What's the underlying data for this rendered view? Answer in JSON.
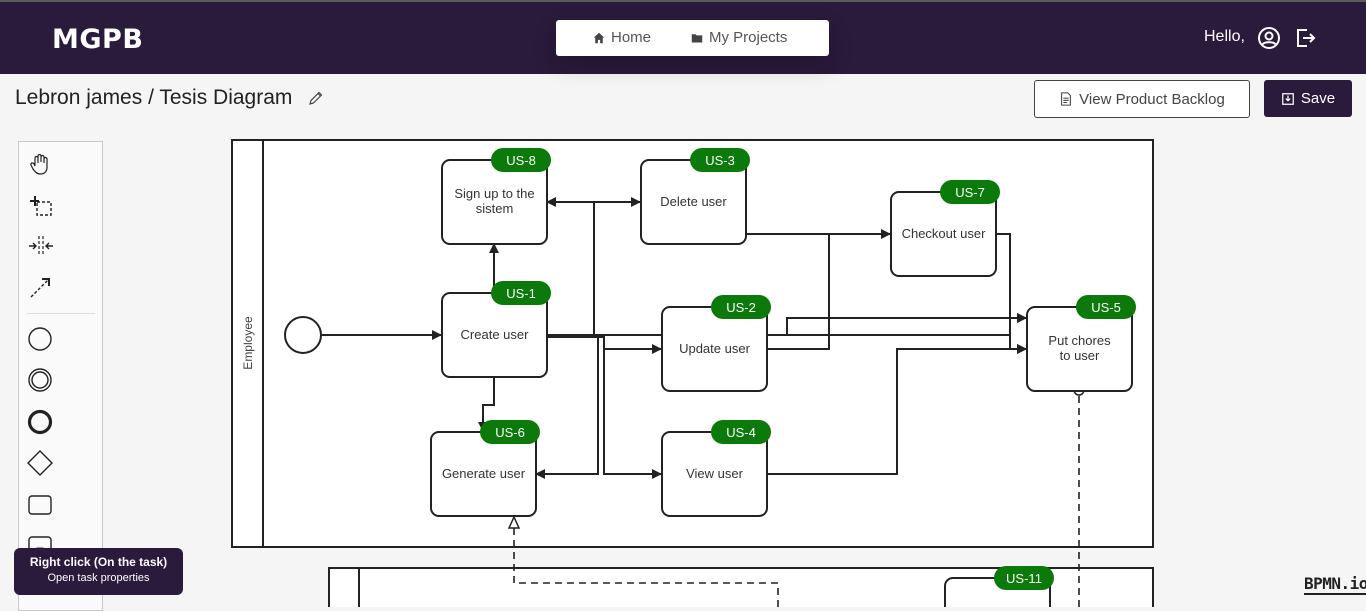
{
  "header": {
    "logo": "MGPB",
    "nav": {
      "home": "Home",
      "projects": "My Projects"
    },
    "greeting": "Hello,"
  },
  "toolbar": {
    "breadcrumb": "Lebron james / Tesis Diagram",
    "view_backlog_label": "View Product Backlog",
    "save_label": "Save"
  },
  "diagram": {
    "lane_label": "Employee",
    "tasks": [
      {
        "id": "t-signup",
        "label_line1": "Sign up to the",
        "label_line2": "sistem",
        "badge": "US-8"
      },
      {
        "id": "t-delete",
        "label_line1": "Delete user",
        "label_line2": "",
        "badge": "US-3"
      },
      {
        "id": "t-checkout",
        "label_line1": "Checkout user",
        "label_line2": "",
        "badge": "US-7"
      },
      {
        "id": "t-create",
        "label_line1": "Create user",
        "label_line2": "",
        "badge": "US-1"
      },
      {
        "id": "t-update",
        "label_line1": "Update user",
        "label_line2": "",
        "badge": "US-2"
      },
      {
        "id": "t-putchores",
        "label_line1": "Put chores",
        "label_line2": "to user",
        "badge": "US-5"
      },
      {
        "id": "t-generate",
        "label_line1": "Generate user",
        "label_line2": "",
        "badge": "US-6"
      },
      {
        "id": "t-view",
        "label_line1": "View user",
        "label_line2": "",
        "badge": "US-4"
      },
      {
        "id": "t-lower",
        "label_line1": "",
        "label_line2": "",
        "badge": "US-11"
      }
    ],
    "colors": {
      "badge": "#0b7a0b",
      "header": "#2a1a3b",
      "stroke": "#222222"
    }
  },
  "palette": {
    "tools": [
      "hand-tool-icon",
      "lasso-tool-icon",
      "space-tool-icon",
      "connect-tool-icon",
      "start-event-icon",
      "intermediate-event-icon",
      "end-event-icon",
      "gateway-icon",
      "task-icon",
      "data-object-icon"
    ]
  },
  "tooltip": {
    "title": "Right click (On the task)",
    "subtitle": "Open task properties"
  },
  "watermark": "BPMN.io"
}
